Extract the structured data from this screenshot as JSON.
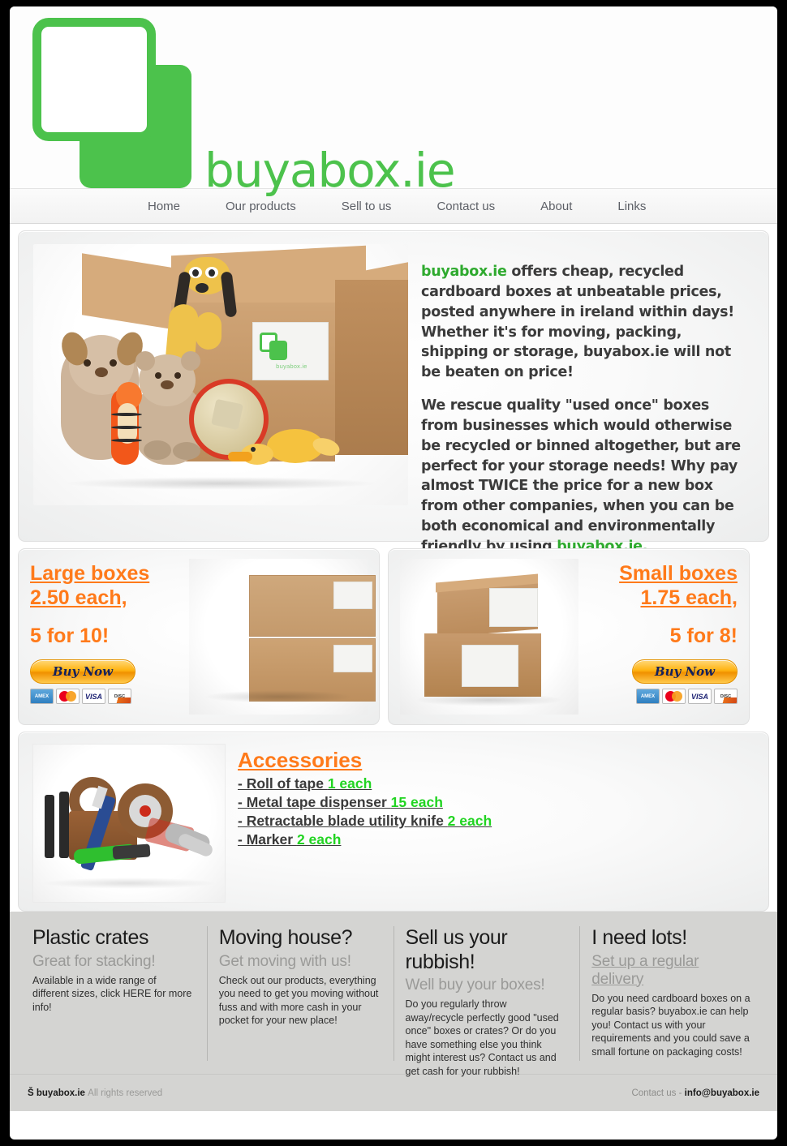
{
  "site": {
    "logo_text": "buyabox.ie",
    "logo_color": "#4cc24c"
  },
  "nav": {
    "items": [
      {
        "label": "Home"
      },
      {
        "label": "Our products"
      },
      {
        "label": "Sell to us"
      },
      {
        "label": "Contact us"
      },
      {
        "label": "About"
      },
      {
        "label": "Links"
      }
    ]
  },
  "hero": {
    "image_alt": "cardboard box filled with soft toys, teddy bears, football and a buyabox.ie label",
    "p1_brand": "buyabox.ie",
    "p1_rest": " offers cheap, recycled cardboard boxes at unbeatable prices, posted anywhere in ireland within days! Whether it's for moving, packing, shipping or storage, buyabox.ie will not be beaten on price!",
    "p2_text": "We rescue quality \"used once\" boxes from businesses which would otherwise be recycled or binned altogether, but are perfect for your storage needs! Why pay almost TWICE the price for a new box from other companies, when you can be both economical and environmentally friendly by using ",
    "p2_brand": "buyabox.ie.",
    "label_logo_text": "buyabox.ie"
  },
  "products": [
    {
      "title": "Large boxes ",
      "price_line": "2.50 each,",
      "bulk": "5 for 10!",
      "buy_label": "Buy Now",
      "image_alt": "two stacked large cardboard boxes with white shipping labels"
    },
    {
      "title": "Small boxes ",
      "price_line": "1.75 each,",
      "bulk": "5 for 8!",
      "buy_label": "Buy Now",
      "image_alt": "two small cardboard boxes stacked with white shipping labels"
    }
  ],
  "payment_cards": [
    {
      "name": "american-express",
      "label": "AMERICAN EXPRESS"
    },
    {
      "name": "mastercard",
      "label": "MasterCard"
    },
    {
      "name": "visa",
      "label": "VISA"
    },
    {
      "name": "discover",
      "label": "DISCOVER"
    }
  ],
  "accessories": {
    "title": "Accessories",
    "image_alt": "packing tape rolls, tape dispenser, utility knives and markers",
    "items": [
      {
        "name": "- Roll of tape ",
        "price": "1 each"
      },
      {
        "name": "- Metal tape dispenser ",
        "price": "15 each"
      },
      {
        "name": "- Retractable blade utility knife ",
        "price": "2 each"
      },
      {
        "name": "- Marker ",
        "price": "2 each"
      }
    ]
  },
  "bottom_columns": [
    {
      "heading": "Plastic crates",
      "subheading": "Great for stacking!",
      "sub_is_link": false,
      "body": "Available in a wide range of different sizes, click HERE for more info!"
    },
    {
      "heading": "Moving house?",
      "subheading": "Get moving with us!",
      "sub_is_link": false,
      "body": "Check out our products, everything you need to get you moving without fuss and with more cash in your pocket for your new place!"
    },
    {
      "heading": "Sell us your rubbish!",
      "subheading": "Well buy your boxes!",
      "sub_is_link": false,
      "body": "Do you regularly throw away/recycle perfectly good \"used once\" boxes or crates? Or do you have something else you think might interest us? Contact us and get cash for your rubbish!"
    },
    {
      "heading": "I need lots!",
      "subheading": "Set up a regular delivery",
      "sub_is_link": true,
      "body": "Do you need cardboard boxes on a regular basis? buyabox.ie can help you! Contact us with your requirements and you could save a small fortune on packaging costs!"
    }
  ],
  "footer": {
    "copyright_mark": "Š",
    "site": "buyabox.ie",
    "rights": "All rights reserved",
    "contact_label": "Contact us - ",
    "email": "info@buyabox.ie"
  },
  "colors": {
    "brand_green": "#4cc24c",
    "price_orange": "#ff7a1a",
    "accessory_green": "#21d421",
    "footer_bg": "#d4d4d2"
  }
}
